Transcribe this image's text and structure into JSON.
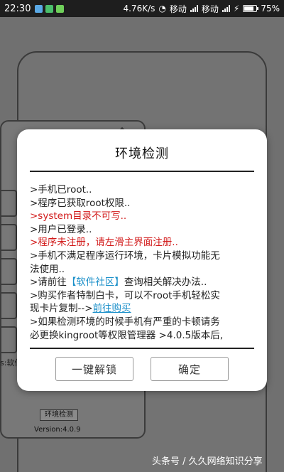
{
  "status_bar": {
    "time": "22:30",
    "net_speed": "4.76K/s",
    "carrier1": "移动",
    "carrier2": "移动",
    "battery": "75%"
  },
  "background": {
    "left_text": "s:软件",
    "env_button_label": "环境检测",
    "version": "Version:4.0.9"
  },
  "dialog": {
    "title": "环境检测",
    "log": [
      {
        "text": ">手机已root..",
        "style": "normal"
      },
      {
        "text": ">程序已获取root权限..",
        "style": "normal"
      },
      {
        "text": ">system目录不可写..",
        "style": "err"
      },
      {
        "text": ">用户已登录..",
        "style": "normal"
      },
      {
        "text": ">程序未注册，请左滑主界面注册..",
        "style": "err"
      }
    ],
    "env_line1": ">手机不满足程序运行环境，卡片模拟功能无",
    "env_line2": "法使用..",
    "community_prefix": ">请前往",
    "community_link": "【软件社区】",
    "community_suffix": "查询相关解决办法..",
    "buy_line1": ">购买作者特制白卡，可以不root手机轻松实",
    "buy_line2_prefix": "现卡片复制-->",
    "buy_link": "前往购买",
    "stuck_line1": ">如果检测环境的时候手机有严重的卡顿请务",
    "stuck_line2": "必更换kingroot等权限管理器 >4.0.5版本后,",
    "buttons": {
      "unlock": "一键解锁",
      "confirm": "确定"
    }
  },
  "watermark": "头条号 / 久久网络知识分享"
}
